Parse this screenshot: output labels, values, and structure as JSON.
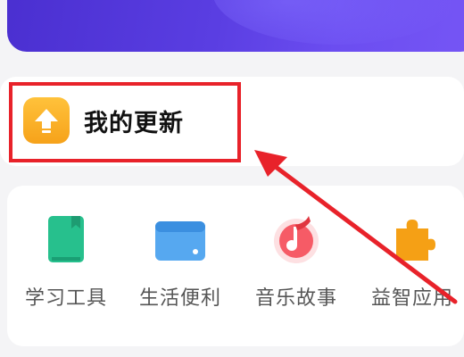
{
  "update_section": {
    "title": "我的更新"
  },
  "categories": [
    {
      "label": "学习工具",
      "icon": "book-icon"
    },
    {
      "label": "生活便利",
      "icon": "wallet-card-icon"
    },
    {
      "label": "音乐故事",
      "icon": "music-note-icon"
    },
    {
      "label": "益智应用",
      "icon": "puzzle-icon"
    }
  ],
  "colors": {
    "highlight": "#e8222a",
    "update_icon": "#f7a81f",
    "banner": "#5a3ee2"
  }
}
